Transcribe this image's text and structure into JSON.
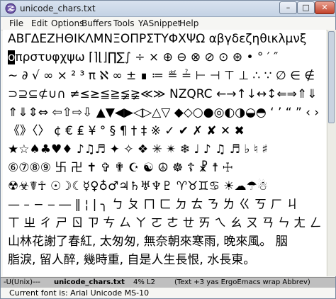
{
  "window": {
    "title": "unicode_chars.txt",
    "minimize_glyph": "–",
    "maximize_glyph": "□",
    "close_glyph": "✕"
  },
  "menu": [
    {
      "label": "File"
    },
    {
      "label": "Edit"
    },
    {
      "label": "Options"
    },
    {
      "label": "Buffers"
    },
    {
      "label": "Tools"
    },
    {
      "label": "YASnippet"
    },
    {
      "label": "Help"
    }
  ],
  "buffer": {
    "lines": [
      "ΑΒΓΔΕΖΗΘΙΚΛΜΝΞΟΠΡΣΤΥΦΧΨΩ αβγδεζηθικλμνξ",
      "οπρστυφχψω ⌈⌉⌊⌋∏∑∫ ÷ × ⊕ ⊖ ⊗ ⊘ ⊙ ⊛ • ° ′ ″",
      "∼ ∂ √ ∞ × ² ³ π ℵ ∞ ± ∎ ≔ ≝ ≟ ⊢ ⊣ ⊤ ⊥ ∴ ∵ ∅ ∈ ∉",
      "⊃⊇⊆⊄∪∩ ≠≤≥≦≧≨≩≪≫ NZQRC ←→↑↓↔↕⇐⇒⇑⇓",
      "⇑⇓⇕⇔ ⇦⇧⇨⇩ ▲▼◀▶◁▷△▽ ◆◇○●◎◐◑◒◓ ‘ ’ “ ” ‹ ›",
      "《》〈〉 ¢ € ₤ ¥ ° § ¶ † ‡ ※ ✓ ✔ ✗ ✘ ✕ ✖",
      "★☆♠♣♥♦ ♪♫♬ ✦ ✧ ❖ ✳ ✴ ❄ ♩ ♪ ♫ ♬ ♭ ♮ ♯",
      "⑥⑦⑧⑨ 卐 卍 ✝ ✞ ✟ ☪ ☯ ☮ ☸ ☦ ☧ ☨ ☩",
      "☢☣☤☥ ☉☽☾☿♀♁♂♃♄♅♆♇ ♈♉♊♋ ☀☁☂☃",
      "— – − ‒ ― ‖ ¦ | ╮ ㄅ ㄆ ㄇ ㄈ ㄉ ㄊ ㄋ ㄌ ㄍ ㄎ ㄏ ㄐ",
      "ㄒ ㄓ ㄔ ㄕ ㄖ ㄗ ㄘ ㄙ ㄚ ㄛ ㄜ ㄝ ㄞ ㄟ ㄠ ㄡ ㄢ ㄣ ㄤ ㄥ ㄦ",
      "山林花謝了春紅, 太匆匆, 無奈朝來寒雨, 晚來風。 胭",
      "脂淚, 留人醉, 幾時重, 自是人生長恨, 水長東。"
    ],
    "cursor_char": "ο",
    "cursor_rest_line1": "πρστυφχψω ⌈⌉⌊⌋∏∑∫ ÷ × ⊕ ⊖ ⊗ ⊘ ⊙ ⊛ • ° ′ ″"
  },
  "modeline": {
    "status": "-U(Unix)---",
    "buffer_name": "unicode_chars.txt",
    "position": "4% L2",
    "modes": "(Text +3 yas ErgoEmacs wrap Abbrev)"
  },
  "minibuffer": {
    "message": "Current font is: Arial Unicode MS-10"
  }
}
